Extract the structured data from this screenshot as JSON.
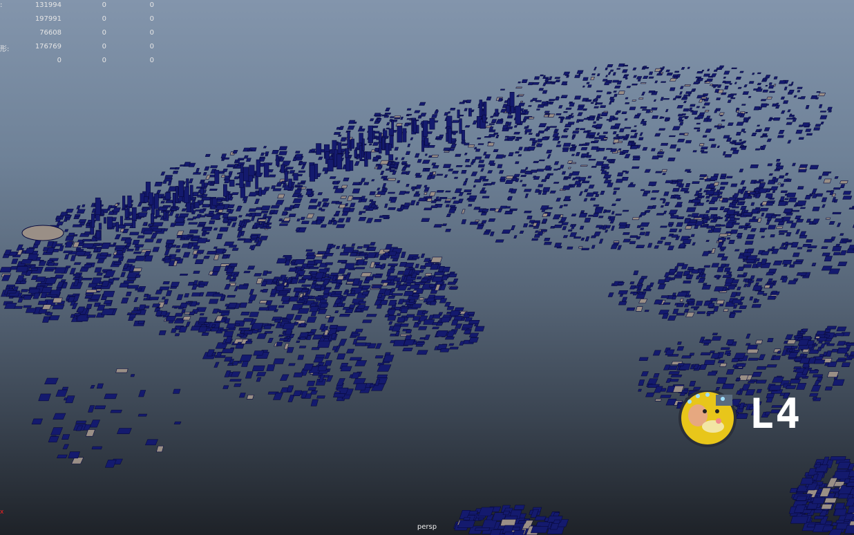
{
  "viewport": {
    "camera_label": "persp",
    "axis_indicator": "x"
  },
  "hud": {
    "rows": [
      {
        "label": ":",
        "c1": "131994",
        "c2": "0",
        "c3": "0"
      },
      {
        "label": "",
        "c1": "197991",
        "c2": "0",
        "c3": "0"
      },
      {
        "label": "",
        "c1": "76608",
        "c2": "0",
        "c3": "0"
      },
      {
        "label": "形:",
        "c1": "176769",
        "c2": "0",
        "c3": "0"
      },
      {
        "label": "",
        "c1": "0",
        "c2": "0",
        "c3": "0"
      }
    ]
  },
  "watermark": {
    "text": "L4",
    "description_icon": "duck-avatar-icon"
  },
  "colors": {
    "building_fill": "#141a6e",
    "building_edge": "#07093d",
    "plaza_fill": "#9a8f86"
  }
}
